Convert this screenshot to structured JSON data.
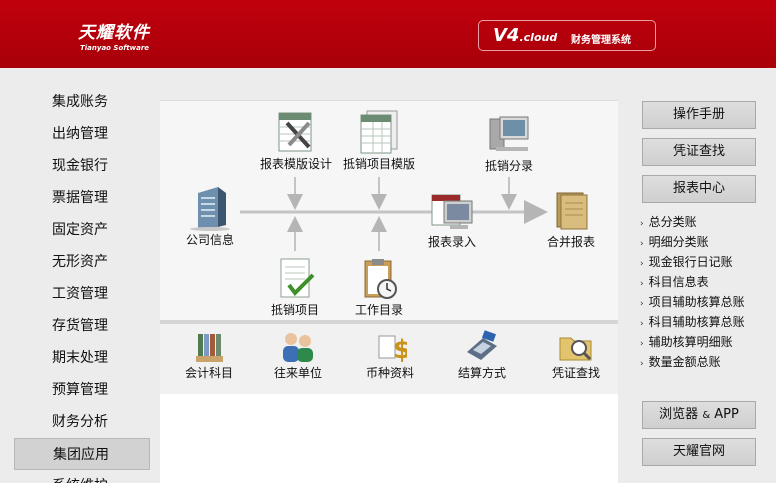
{
  "header": {
    "logo_cn": "天耀软件",
    "logo_en": "Tianyao Software",
    "version": "V4",
    "version_suffix": ".cloud",
    "system_name": "财务管理系统"
  },
  "left_nav": [
    "集成账务",
    "出纳管理",
    "现金银行",
    "票据管理",
    "固定资产",
    "无形资产",
    "工资管理",
    "存货管理",
    "期末处理",
    "预算管理",
    "财务分析",
    "集团应用",
    "系统维护"
  ],
  "flow": {
    "company_info": "公司信息",
    "report_template_design": "报表模版设计",
    "writeoff_item_template": "抵销项目模版",
    "writeoff_entry": "抵销分录",
    "report_entry": "报表录入",
    "consolidated_report": "合并报表",
    "writeoff_item": "抵销项目",
    "work_catalog": "工作目录"
  },
  "bottom_icons": [
    "会计科目",
    "往来单位",
    "币种资料",
    "结算方式",
    "凭证查找"
  ],
  "right": {
    "manual": "操作手册",
    "voucher_search": "凭证查找",
    "report_center": "报表中心",
    "report_links": [
      "总分类账",
      "明细分类账",
      "现金银行日记账",
      "科目信息表",
      "项目辅助核算总账",
      "科目辅助核算总账",
      "辅助核算明细账",
      "数量金额总账"
    ],
    "browser_app": "浏览器",
    "browser_app_amp": "&",
    "browser_app_2": "APP",
    "official_site": "天耀官网"
  },
  "colors": {
    "header": "#b3000b",
    "active_nav": "#d2d2d2"
  }
}
